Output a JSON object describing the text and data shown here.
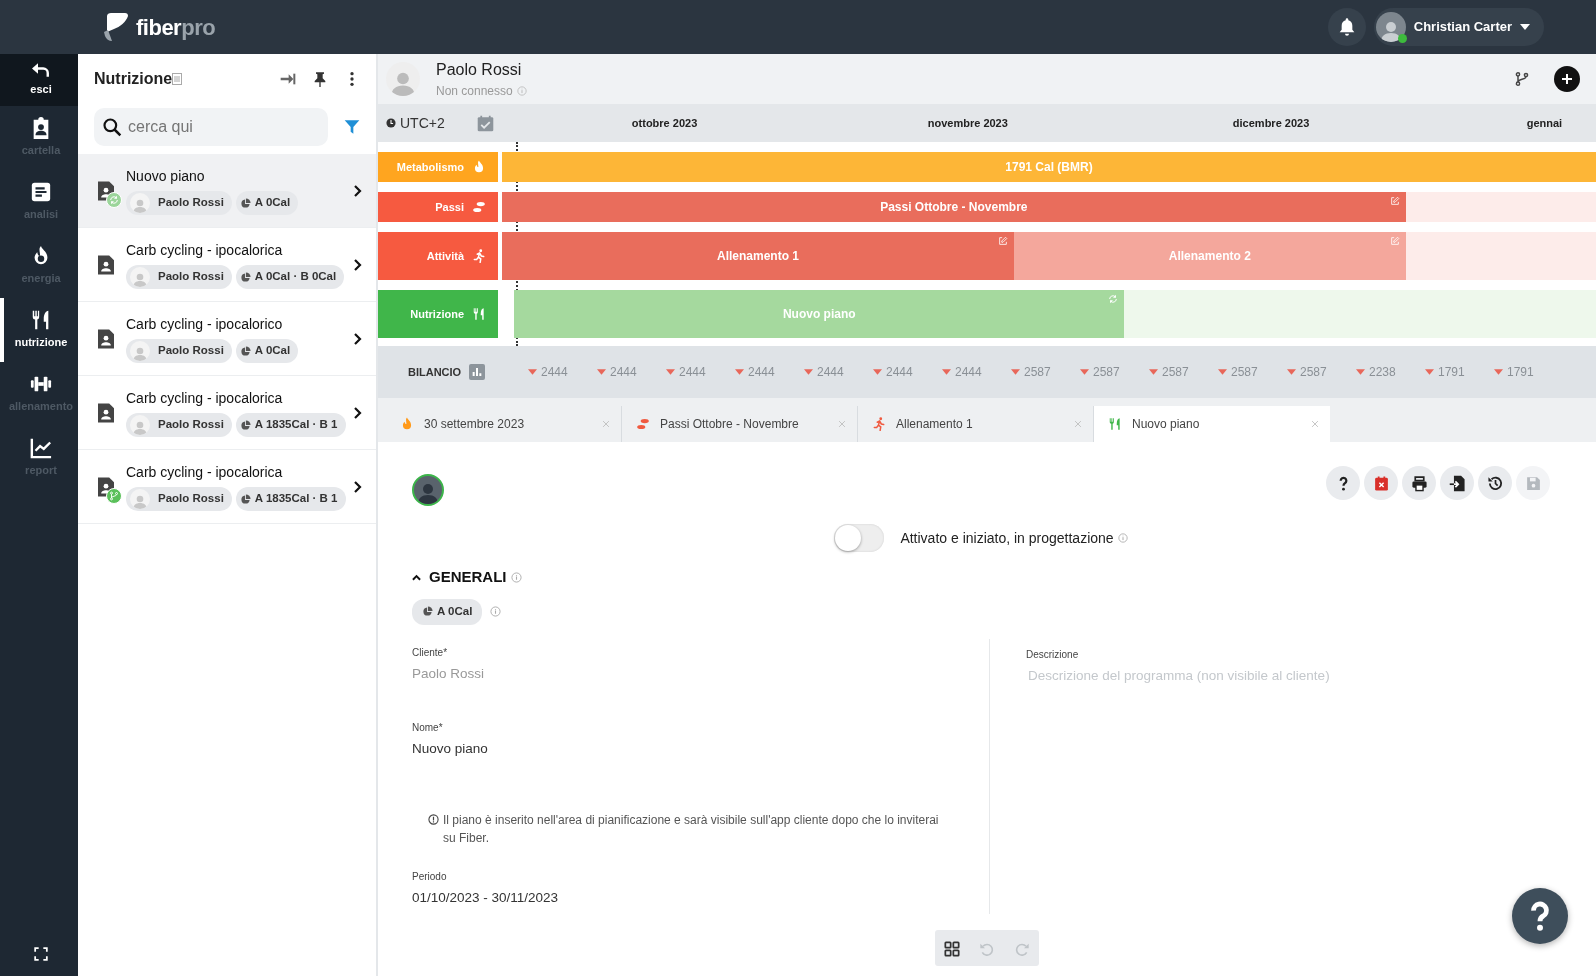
{
  "logo": {
    "main": "fiber",
    "accent": "pro"
  },
  "user": {
    "name": "Christian Carter",
    "online": true
  },
  "rail": {
    "back": {
      "label": "esci"
    },
    "items": [
      {
        "label": "cartella",
        "selected": false
      },
      {
        "label": "analisi",
        "selected": false
      },
      {
        "label": "energia",
        "selected": false
      },
      {
        "label": "nutrizione",
        "selected": true
      },
      {
        "label": "allenamento",
        "selected": false
      },
      {
        "label": "report",
        "selected": false
      }
    ]
  },
  "panel": {
    "title": "Nutrizione",
    "search": {
      "placeholder": "cerca qui"
    },
    "plans": [
      {
        "title": "Nuovo piano",
        "client": "Paolo Rossi",
        "summary": "A 0Cal",
        "selected": true,
        "synced": true,
        "branched": false
      },
      {
        "title": "Carb cycling - ipocalorica",
        "client": "Paolo Rossi",
        "summary": "A 0Cal · B 0Cal",
        "selected": false,
        "synced": false,
        "branched": false
      },
      {
        "title": "Carb cycling - ipocalorico",
        "client": "Paolo Rossi",
        "summary": "A 0Cal",
        "selected": false,
        "synced": false,
        "branched": false
      },
      {
        "title": "Carb cycling - ipocalorica",
        "client": "Paolo Rossi",
        "summary": "A 1835Cal · B 1",
        "selected": false,
        "synced": false,
        "branched": false
      },
      {
        "title": "Carb cycling - ipocalorica",
        "client": "Paolo Rossi",
        "summary": "A 1835Cal · B 1",
        "selected": false,
        "synced": false,
        "branched": true
      }
    ]
  },
  "client": {
    "name": "Paolo Rossi",
    "status": "Non connesso"
  },
  "timeline": {
    "timezone": "UTC+2",
    "months": [
      "ottobre 2023",
      "novembre 2023",
      "dicembre 2023",
      "gennai"
    ],
    "rows": [
      {
        "label": "Metabolismo",
        "kind": "metabolism",
        "bars": [
          {
            "label": "1791 Cal (BMR)",
            "faded": false,
            "editable": false,
            "synced": false
          }
        ]
      },
      {
        "label": "Passi",
        "kind": "steps",
        "bars": [
          {
            "label": "Passi Ottobre - Novembre",
            "faded": false,
            "editable": true,
            "synced": false
          }
        ]
      },
      {
        "label": "Attività",
        "kind": "activity",
        "bars": [
          {
            "label": "Allenamento 1",
            "faded": false,
            "editable": true,
            "synced": false
          },
          {
            "label": "Allenamento 2",
            "faded": true,
            "editable": true,
            "synced": false
          }
        ]
      },
      {
        "label": "Nutrizione",
        "kind": "nutrition",
        "bars": [
          {
            "label": "Nuovo piano",
            "faded": true,
            "editable": false,
            "synced": true
          }
        ]
      }
    ]
  },
  "balance": {
    "label": "BILANCIO",
    "values": [
      "2444",
      "2444",
      "2444",
      "2444",
      "2444",
      "2444",
      "2444",
      "2587",
      "2587",
      "2587",
      "2587",
      "2587",
      "2238",
      "1791",
      "1791"
    ]
  },
  "tabs": [
    {
      "label": "30 settembre 2023",
      "kind": "metabolism",
      "selected": false
    },
    {
      "label": "Passi Ottobre - Novembre",
      "kind": "steps",
      "selected": false
    },
    {
      "label": "Allenamento 1",
      "kind": "activity",
      "selected": false
    },
    {
      "label": "Nuovo piano",
      "kind": "nutrition",
      "selected": true
    }
  ],
  "plan": {
    "active": false,
    "status_text": "Attivato e iniziato, in progettazione",
    "save_disabled": true,
    "section": {
      "title": "GENERALI",
      "expanded": true
    },
    "summary": "A 0Cal",
    "client_field": {
      "label": "Cliente*",
      "value": "Paolo Rossi",
      "disabled": true
    },
    "name_field": {
      "label": "Nome*",
      "value": "Nuovo piano"
    },
    "note": "Il piano è inserito nell'area di pianificazione e sarà visibile sull'app cliente dopo che lo inviterai su Fiber.",
    "period_field": {
      "label": "Periodo",
      "value": "01/10/2023 - 30/11/2023"
    },
    "description_field": {
      "label": "Descrizione",
      "placeholder": "Descrizione del programma (non visibile al cliente)"
    }
  },
  "toolbar": {
    "undo_disabled": true,
    "redo_disabled": true
  }
}
